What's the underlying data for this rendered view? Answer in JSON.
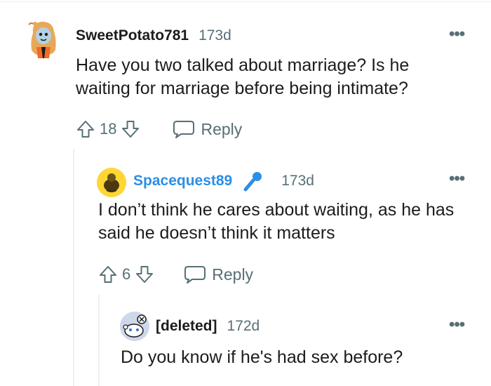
{
  "comments": [
    {
      "username": "SweetPotato781",
      "time": "173d",
      "text": "Have you two talked about marriage? Is he waiting for marriage before being intimate?",
      "votes": "18",
      "reply_label": "Reply",
      "more_label": "•••",
      "username_color": "#1c1c1c"
    },
    {
      "username": "Spacequest89",
      "time": "173d",
      "text": "I don’t think he cares about waiting, as he has said he doesn’t think it matters",
      "votes": "6",
      "reply_label": "Reply",
      "more_label": "•••",
      "username_color": "#2c8ee6",
      "flair_icon": "microphone-icon"
    },
    {
      "username": "[deleted]",
      "time": "172d",
      "text": "Do you know if he's had sex before?",
      "more_label": "•••",
      "username_color": "#1c1c1c"
    }
  ],
  "colors": {
    "meta_gray": "#576f76",
    "link_blue": "#2c8ee6",
    "thread_line": "#edeff1"
  }
}
